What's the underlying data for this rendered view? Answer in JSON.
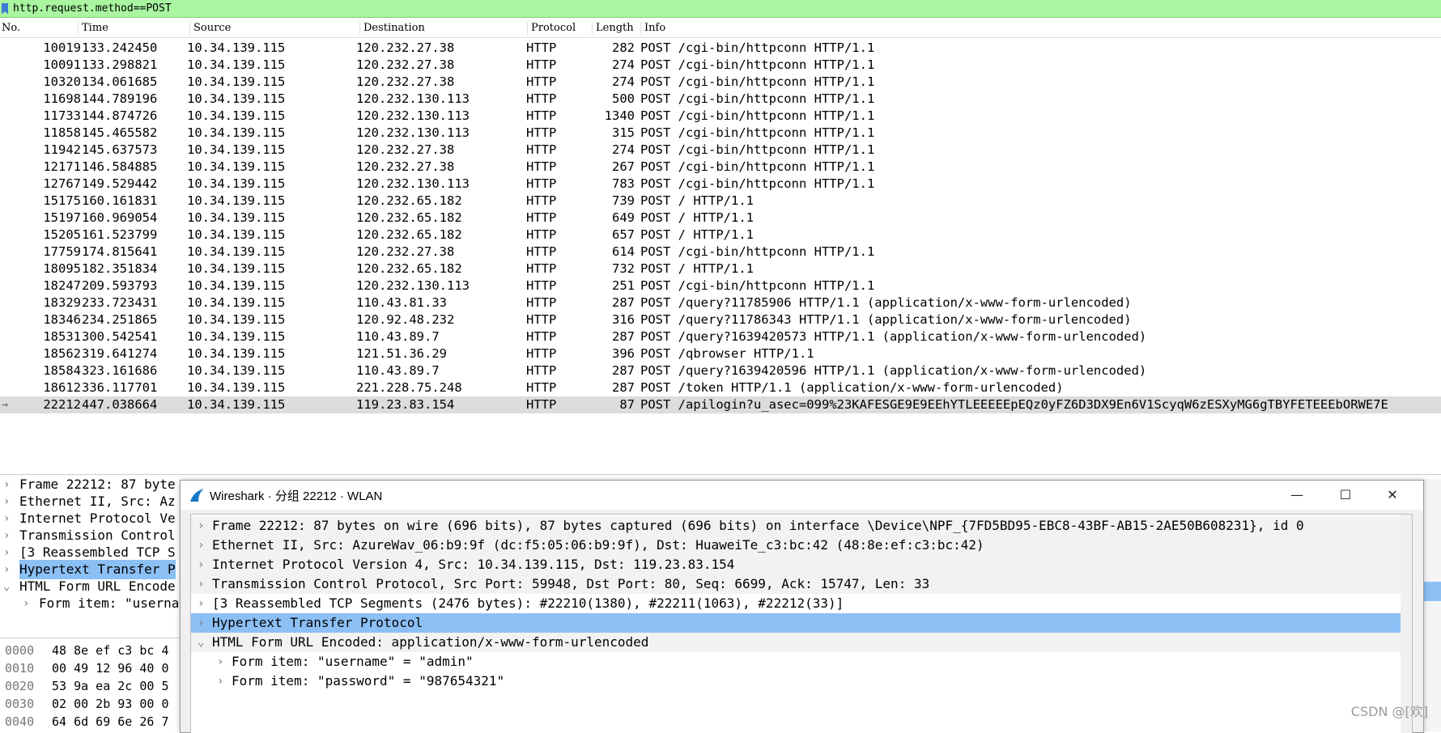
{
  "filter": {
    "value": "http.request.method==POST"
  },
  "columns": [
    "No.",
    "Time",
    "Source",
    "Destination",
    "Protocol",
    "Length",
    "Info"
  ],
  "packets": [
    {
      "no": "10019",
      "time": "133.242450",
      "src": "10.34.139.115",
      "dst": "120.232.27.38",
      "proto": "HTTP",
      "len": "282",
      "info": "POST /cgi-bin/httpconn HTTP/1.1"
    },
    {
      "no": "10091",
      "time": "133.298821",
      "src": "10.34.139.115",
      "dst": "120.232.27.38",
      "proto": "HTTP",
      "len": "274",
      "info": "POST /cgi-bin/httpconn HTTP/1.1"
    },
    {
      "no": "10320",
      "time": "134.061685",
      "src": "10.34.139.115",
      "dst": "120.232.27.38",
      "proto": "HTTP",
      "len": "274",
      "info": "POST /cgi-bin/httpconn HTTP/1.1"
    },
    {
      "no": "11698",
      "time": "144.789196",
      "src": "10.34.139.115",
      "dst": "120.232.130.113",
      "proto": "HTTP",
      "len": "500",
      "info": "POST /cgi-bin/httpconn HTTP/1.1"
    },
    {
      "no": "11733",
      "time": "144.874726",
      "src": "10.34.139.115",
      "dst": "120.232.130.113",
      "proto": "HTTP",
      "len": "1340",
      "info": "POST /cgi-bin/httpconn HTTP/1.1"
    },
    {
      "no": "11858",
      "time": "145.465582",
      "src": "10.34.139.115",
      "dst": "120.232.130.113",
      "proto": "HTTP",
      "len": "315",
      "info": "POST /cgi-bin/httpconn HTTP/1.1"
    },
    {
      "no": "11942",
      "time": "145.637573",
      "src": "10.34.139.115",
      "dst": "120.232.27.38",
      "proto": "HTTP",
      "len": "274",
      "info": "POST /cgi-bin/httpconn HTTP/1.1"
    },
    {
      "no": "12171",
      "time": "146.584885",
      "src": "10.34.139.115",
      "dst": "120.232.27.38",
      "proto": "HTTP",
      "len": "267",
      "info": "POST /cgi-bin/httpconn HTTP/1.1"
    },
    {
      "no": "12767",
      "time": "149.529442",
      "src": "10.34.139.115",
      "dst": "120.232.130.113",
      "proto": "HTTP",
      "len": "783",
      "info": "POST /cgi-bin/httpconn HTTP/1.1"
    },
    {
      "no": "15175",
      "time": "160.161831",
      "src": "10.34.139.115",
      "dst": "120.232.65.182",
      "proto": "HTTP",
      "len": "739",
      "info": "POST / HTTP/1.1"
    },
    {
      "no": "15197",
      "time": "160.969054",
      "src": "10.34.139.115",
      "dst": "120.232.65.182",
      "proto": "HTTP",
      "len": "649",
      "info": "POST / HTTP/1.1"
    },
    {
      "no": "15205",
      "time": "161.523799",
      "src": "10.34.139.115",
      "dst": "120.232.65.182",
      "proto": "HTTP",
      "len": "657",
      "info": "POST / HTTP/1.1"
    },
    {
      "no": "17759",
      "time": "174.815641",
      "src": "10.34.139.115",
      "dst": "120.232.27.38",
      "proto": "HTTP",
      "len": "614",
      "info": "POST /cgi-bin/httpconn HTTP/1.1"
    },
    {
      "no": "18095",
      "time": "182.351834",
      "src": "10.34.139.115",
      "dst": "120.232.65.182",
      "proto": "HTTP",
      "len": "732",
      "info": "POST / HTTP/1.1"
    },
    {
      "no": "18247",
      "time": "209.593793",
      "src": "10.34.139.115",
      "dst": "120.232.130.113",
      "proto": "HTTP",
      "len": "251",
      "info": "POST /cgi-bin/httpconn HTTP/1.1"
    },
    {
      "no": "18329",
      "time": "233.723431",
      "src": "10.34.139.115",
      "dst": "110.43.81.33",
      "proto": "HTTP",
      "len": "287",
      "info": "POST /query?11785906 HTTP/1.1  (application/x-www-form-urlencoded)"
    },
    {
      "no": "18346",
      "time": "234.251865",
      "src": "10.34.139.115",
      "dst": "120.92.48.232",
      "proto": "HTTP",
      "len": "316",
      "info": "POST /query?11786343 HTTP/1.1  (application/x-www-form-urlencoded)"
    },
    {
      "no": "18531",
      "time": "300.542541",
      "src": "10.34.139.115",
      "dst": "110.43.89.7",
      "proto": "HTTP",
      "len": "287",
      "info": "POST /query?1639420573 HTTP/1.1  (application/x-www-form-urlencoded)"
    },
    {
      "no": "18562",
      "time": "319.641274",
      "src": "10.34.139.115",
      "dst": "121.51.36.29",
      "proto": "HTTP",
      "len": "396",
      "info": "POST /qbrowser HTTP/1.1"
    },
    {
      "no": "18584",
      "time": "323.161686",
      "src": "10.34.139.115",
      "dst": "110.43.89.7",
      "proto": "HTTP",
      "len": "287",
      "info": "POST /query?1639420596 HTTP/1.1  (application/x-www-form-urlencoded)"
    },
    {
      "no": "18612",
      "time": "336.117701",
      "src": "10.34.139.115",
      "dst": "221.228.75.248",
      "proto": "HTTP",
      "len": "287",
      "info": "POST /token HTTP/1.1  (application/x-www-form-urlencoded)"
    },
    {
      "no": "22212",
      "time": "447.038664",
      "src": "10.34.139.115",
      "dst": "119.23.83.154",
      "proto": "HTTP",
      "len": "87",
      "info": "POST /apilogin?u_asec=099%23KAFESGE9E9EEhYTLEEEEEpEQz0yFZ6D3DX9En6V1ScyqW6zESXyMG6gTBYFETEEEbORWE7E"
    }
  ],
  "back_detail": [
    "Frame 22212: 87 byte",
    "Ethernet II, Src: Az",
    "Internet Protocol Ve",
    "Transmission Control",
    "[3 Reassembled TCP S",
    "Hypertext Transfer P",
    "HTML Form URL Encode",
    "Form item: \"usernal"
  ],
  "hex": [
    {
      "off": "0000",
      "hx": "48 8e ef c3 bc 4"
    },
    {
      "off": "0010",
      "hx": "00 49 12 96 40 0"
    },
    {
      "off": "0020",
      "hx": "53 9a ea 2c 00 5"
    },
    {
      "off": "0030",
      "hx": "02 00 2b 93 00 0"
    },
    {
      "off": "0040",
      "hx": "64 6d 69 6e 26 7"
    }
  ],
  "window": {
    "title": "Wireshark · 分组 22212 · WLAN",
    "minimize": "—",
    "maximize": "☐",
    "close": "✕",
    "tree": [
      "Frame 22212: 87 bytes on wire (696 bits), 87 bytes captured (696 bits) on interface \\Device\\NPF_{7FD5BD95-EBC8-43BF-AB15-2AE50B608231}, id 0",
      "Ethernet II, Src: AzureWav_06:b9:9f (dc:f5:05:06:b9:9f), Dst: HuaweiTe_c3:bc:42 (48:8e:ef:c3:bc:42)",
      "Internet Protocol Version 4, Src: 10.34.139.115, Dst: 119.23.83.154",
      "Transmission Control Protocol, Src Port: 59948, Dst Port: 80, Seq: 6699, Ack: 15747, Len: 33",
      "[3 Reassembled TCP Segments (2476 bytes): #22210(1380), #22211(1063), #22212(33)]",
      "Hypertext Transfer Protocol",
      "HTML Form URL Encoded: application/x-www-form-urlencoded",
      "Form item: \"username\" = \"admin\"",
      "Form item: \"password\" = \"987654321\""
    ]
  },
  "watermark": "CSDN @[欢]",
  "colors": {
    "filter_bg": "#a9f5a0",
    "selection": "#8cc0f5",
    "selected_row": "#dcdcdc"
  }
}
